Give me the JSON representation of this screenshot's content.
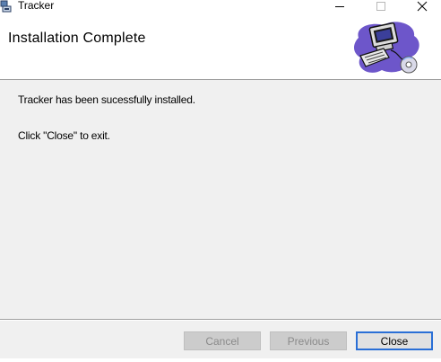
{
  "window": {
    "title": "Tracker",
    "icon": "installer-app-icon",
    "controls": [
      "minimize",
      "maximize",
      "close"
    ]
  },
  "header": {
    "title": "Installation Complete",
    "art_icon": "computer-with-disc-icon"
  },
  "body": {
    "message_installed": "Tracker has been sucessfully installed.",
    "message_exit": "Click \"Close\" to exit."
  },
  "buttons": {
    "cancel": {
      "label": "Cancel",
      "enabled": false
    },
    "previous": {
      "label": "Previous",
      "enabled": false
    },
    "close": {
      "label": "Close",
      "enabled": true,
      "default": true
    }
  },
  "colors": {
    "dialog_bg": "#f0f0f0",
    "header_bg": "#ffffff",
    "default_button_border": "#2a6fd6",
    "disabled_text": "#8a8a8a"
  }
}
